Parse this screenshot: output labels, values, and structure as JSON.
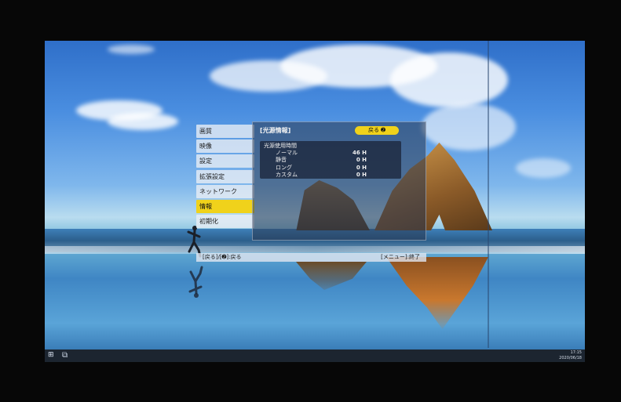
{
  "osd": {
    "menu_items": [
      "画質",
      "映像",
      "設定",
      "拡張設定",
      "ネットワーク",
      "情報",
      "初期化"
    ],
    "active_item": "情報",
    "panel_title": "[光源情報]",
    "back_button": "戻る ➋",
    "section_label": "光源使用時間",
    "rows": [
      {
        "label": "ノーマル",
        "value": "46 H"
      },
      {
        "label": "静音",
        "value": "0 H"
      },
      {
        "label": "ロング",
        "value": "0 H"
      },
      {
        "label": "カスタム",
        "value": "0 H"
      }
    ],
    "hint_left": "[戻る]/[➋]:戻る",
    "hint_right": "[メニュー]:終了"
  },
  "taskbar": {
    "start_icon": "windows-logo-icon",
    "search_icon": "task-view-icon",
    "clock_time": "17:15",
    "clock_date": "2020/06/18"
  },
  "colors": {
    "highlight": "#f0d21b",
    "menu_bg": "#ebeef5",
    "panel_bg": "#28374f"
  }
}
